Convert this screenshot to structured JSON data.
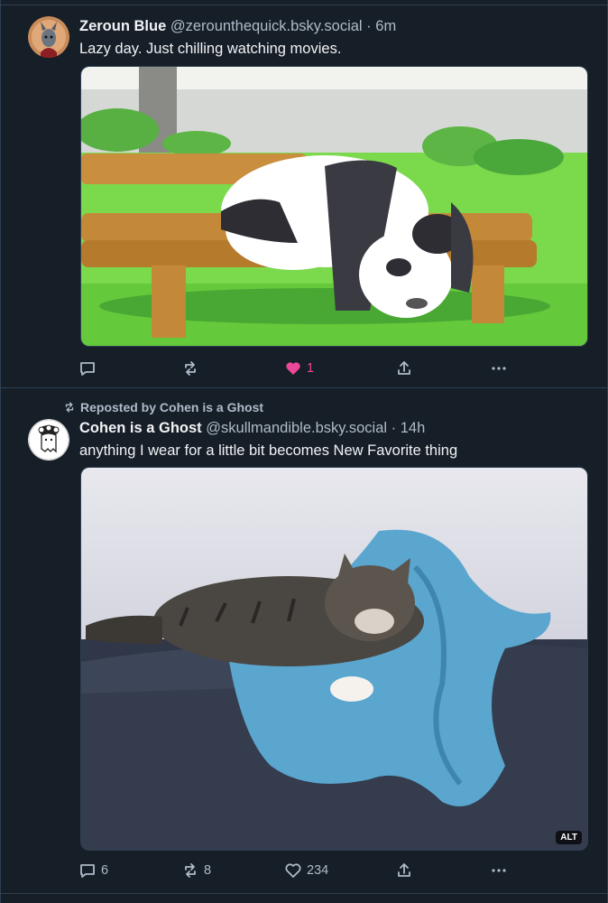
{
  "posts": [
    {
      "author_name": "Zeroun Blue",
      "handle": "@zerounthequick.bsky.social",
      "separator": "·",
      "time": "6m",
      "text": "Lazy day. Just chilling watching movies.",
      "media": {
        "description_icon": "panda-gif-image"
      },
      "actions": {
        "reply_count": "",
        "repost_count": "",
        "like_count": "1",
        "liked": true
      }
    },
    {
      "repost_label": "Reposted by Cohen is a Ghost",
      "author_name": "Cohen is a Ghost",
      "handle": "@skullmandible.bsky.social",
      "separator": "·",
      "time": "14h",
      "text": "anything I wear for a little bit becomes New Favorite thing",
      "media": {
        "alt_label": "ALT",
        "description_icon": "cat-photo-image"
      },
      "actions": {
        "reply_count": "6",
        "repost_count": "8",
        "like_count": "234",
        "liked": false
      }
    }
  ],
  "colors": {
    "background": "#161e27",
    "border": "#2e4052",
    "muted_text": "#aebbc9",
    "like_pink": "#ec4899"
  }
}
